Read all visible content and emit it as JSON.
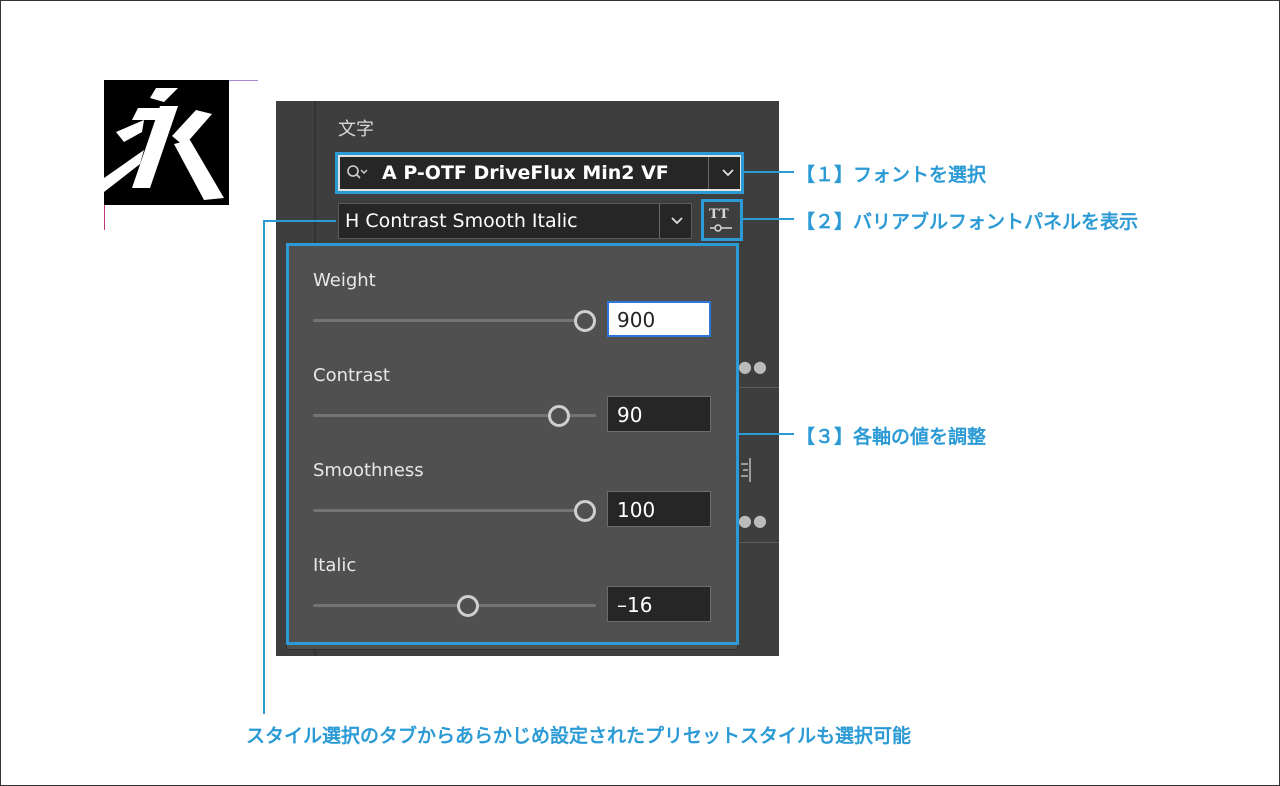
{
  "sample_glyph": {
    "character": "永"
  },
  "panel": {
    "title": "文字",
    "font_family": "A P-OTF DriveFlux Min2 VF",
    "font_style": "H Contrast Smooth Italic",
    "variable_font_button_icon": "variable-font-icon",
    "axes": [
      {
        "label": "Weight",
        "value": "900",
        "min": 100,
        "max": 900,
        "position": 1.0,
        "focused": true
      },
      {
        "label": "Contrast",
        "value": "90",
        "min": 0,
        "max": 100,
        "position": 0.9,
        "focused": false
      },
      {
        "label": "Smoothness",
        "value": "100",
        "min": 0,
        "max": 100,
        "position": 1.0,
        "focused": false
      },
      {
        "label": "Italic",
        "value": "–16",
        "min": -32,
        "max": 0,
        "position": 0.5,
        "focused": false
      }
    ]
  },
  "callouts": {
    "c1": "【１】フォントを選択",
    "c2": "【２】バリアブルフォントパネルを表示",
    "c3": "【３】各軸の値を調整",
    "footer": "スタイル選択のタブからあらかじめ設定されたプリセットスタイルも選択可能"
  },
  "colors": {
    "accent": "#2c9bd5",
    "panel_bg": "#3e3e3e",
    "popup_bg": "#505050",
    "focus": "#2d77d8"
  }
}
